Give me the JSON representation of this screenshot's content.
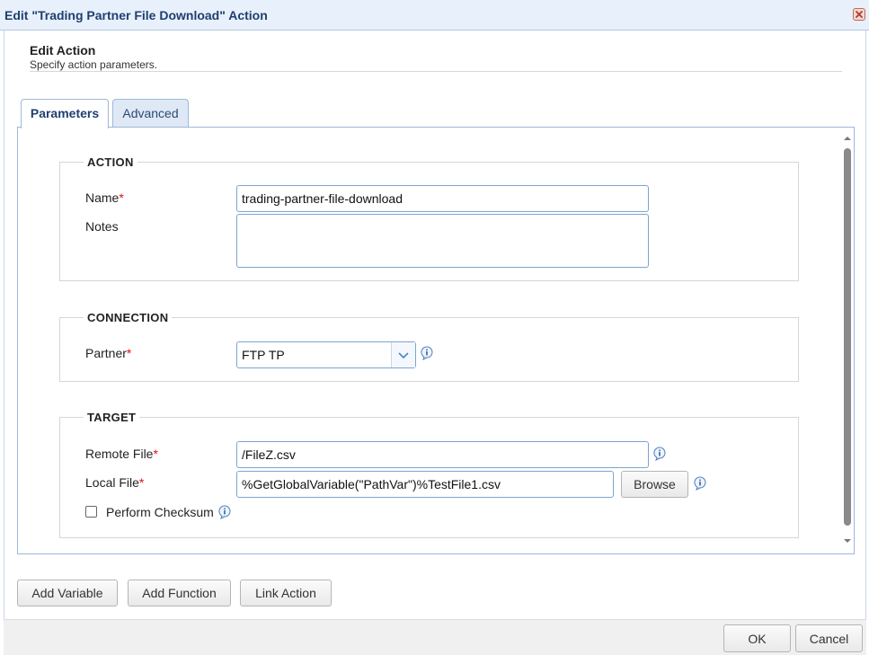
{
  "dialog": {
    "title": "Edit \"Trading Partner File Download\" Action",
    "close_icon": "close-icon"
  },
  "header": {
    "title": "Edit Action",
    "subtitle": "Specify action parameters."
  },
  "tabs": [
    {
      "label": "Parameters",
      "active": true
    },
    {
      "label": "Advanced",
      "active": false
    }
  ],
  "action_section": {
    "legend": "ACTION",
    "name_label": "Name",
    "name_value": "trading-partner-file-download",
    "notes_label": "Notes",
    "notes_value": ""
  },
  "connection_section": {
    "legend": "CONNECTION",
    "partner_label": "Partner",
    "partner_value": "FTP TP"
  },
  "target_section": {
    "legend": "TARGET",
    "remote_file_label": "Remote File",
    "remote_file_value": "/FileZ.csv",
    "local_file_label": "Local File",
    "local_file_value": "%GetGlobalVariable(\"PathVar\")%TestFile1.csv",
    "browse_label": "Browse",
    "checksum_label": "Perform Checksum",
    "checksum_checked": false
  },
  "required_marker": "*",
  "toolbar": {
    "add_variable": "Add Variable",
    "add_function": "Add Function",
    "link_action": "Link Action"
  },
  "footer": {
    "ok": "OK",
    "cancel": "Cancel"
  },
  "colors": {
    "accent": "#1f3f6e",
    "border": "#9fb8d8",
    "required": "#dd1111"
  }
}
